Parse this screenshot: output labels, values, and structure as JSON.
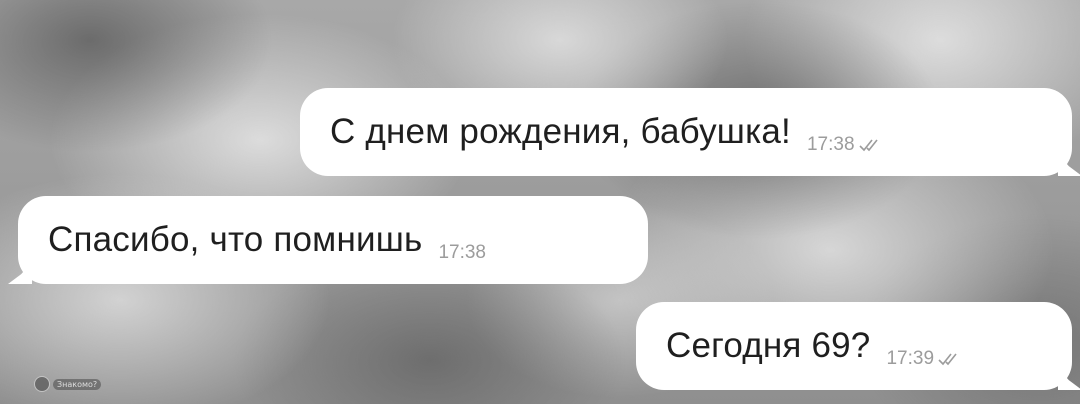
{
  "chat": {
    "messages": [
      {
        "direction": "outgoing",
        "text": "С днем рождения, бабушка!",
        "time": "17:38",
        "status_icon": "double-check-icon"
      },
      {
        "direction": "incoming",
        "text": "Спасибо, что помнишь",
        "time": "17:38"
      },
      {
        "direction": "outgoing",
        "text": "Сегодня 69?",
        "time": "17:39",
        "status_icon": "double-check-icon"
      }
    ]
  },
  "watermark": {
    "text": "Знакомо?"
  },
  "colors": {
    "bubble": "#ffffff",
    "text": "#1f1f1f",
    "meta": "#9c9c9c"
  }
}
